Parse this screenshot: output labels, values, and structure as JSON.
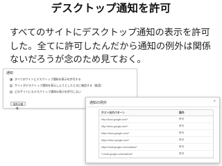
{
  "slide": {
    "title": "デスクトップ通知を許可",
    "body": "すべてのサイトにデスクトップ通知の表示を許可した。全てに許可したんだから通知の例外は関係ないだろうが念のため見ておく。"
  },
  "notifications_panel": {
    "heading": "通知",
    "options": [
      {
        "label": "すべてのサイトにデスクトップ通知の表示を許可する",
        "selected": true
      },
      {
        "label": "サイトがデスクトップ通知を表示しようとしたときに確認する（推奨）",
        "selected": false
      },
      {
        "label": "どのサイトにもデスクトップ通知の表示を許可しない",
        "selected": false
      }
    ],
    "manage_button": "例外の管理..."
  },
  "exceptions_dialog": {
    "title": "通知の例外",
    "close_glyph": "×",
    "columns": {
      "pattern": "ホスト名のパターン",
      "action": "操作"
    },
    "rows": [
      {
        "pattern": "http://docs.google.com/*",
        "action": "許可"
      },
      {
        "pattern": "http://drive.google.com/*",
        "action": "許可"
      },
      {
        "pattern": "https://docs.google.com/*",
        "action": "許可"
      },
      {
        "pattern": "https://drive.google.com/*",
        "action": "許可"
      },
      {
        "pattern": "https://mail.google.com/mail/ca/*",
        "action": "許可"
      },
      {
        "pattern": "*://mail.google.com/mail/ca/*",
        "action": "許可"
      }
    ]
  }
}
